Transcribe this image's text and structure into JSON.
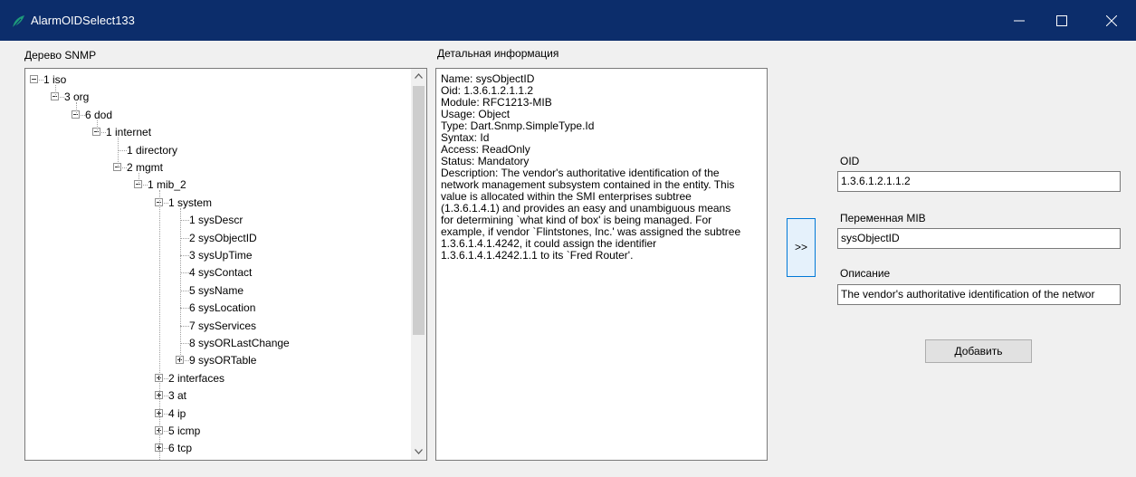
{
  "window": {
    "title": "AlarmOIDSelect133",
    "controls": {
      "minimize": "minimize-icon",
      "maximize": "maximize-icon",
      "close": "close-icon"
    },
    "title_bar_color": "#0c2d6b"
  },
  "tree_panel": {
    "label": "Дерево SNMP",
    "nodes": [
      {
        "label": "1 iso",
        "expanded": true
      },
      {
        "label": "3 org",
        "expanded": true
      },
      {
        "label": "6 dod",
        "expanded": true
      },
      {
        "label": "1 internet",
        "expanded": true
      },
      {
        "label": "1 directory"
      },
      {
        "label": "2 mgmt",
        "expanded": true
      },
      {
        "label": "1 mib_2",
        "expanded": true
      },
      {
        "label": "1 system",
        "expanded": true
      },
      {
        "label": "1 sysDescr"
      },
      {
        "label": "2 sysObjectID",
        "selected": true
      },
      {
        "label": "3 sysUpTime"
      },
      {
        "label": "4 sysContact"
      },
      {
        "label": "5 sysName"
      },
      {
        "label": "6 sysLocation"
      },
      {
        "label": "7 sysServices"
      },
      {
        "label": "8 sysORLastChange"
      },
      {
        "label": "9 sysORTable",
        "expanded": false
      },
      {
        "label": "2 interfaces",
        "expanded": false
      },
      {
        "label": "3 at",
        "expanded": false
      },
      {
        "label": "4 ip",
        "expanded": false
      },
      {
        "label": "5 icmp",
        "expanded": false
      },
      {
        "label": "6 tcp",
        "expanded": false
      }
    ]
  },
  "detail_panel": {
    "label": "Детальная информация",
    "lines": [
      "Name: sysObjectID",
      "Oid: 1.3.6.1.2.1.1.2",
      "Module: RFC1213-MIB",
      "Usage: Object",
      "Type: Dart.Snmp.SimpleType.Id",
      "Syntax: Id",
      "Access: ReadOnly",
      "Status: Mandatory",
      "Description: The vendor's authoritative identification of the",
      "network management subsystem contained in the entity. This",
      "value is allocated within the SMI enterprises subtree",
      "(1.3.6.1.4.1) and provides an easy and unambiguous means",
      "for determining `what kind of box' is being managed. For",
      "example, if vendor `Flintstones, Inc.' was assigned the subtree",
      "1.3.6.1.4.1.4242, it could assign the identifier",
      "1.3.6.1.4.1.4242.1.1 to its `Fred Router'."
    ]
  },
  "transfer_button": {
    "label": ">>"
  },
  "form": {
    "oid": {
      "label": "OID",
      "value": "1.3.6.1.2.1.1.2"
    },
    "mib_variable": {
      "label": "Переменная MIB",
      "value": "sysObjectID"
    },
    "description": {
      "label": "Описание",
      "value": "The vendor's authoritative identification of the networ"
    },
    "add_button": "Добавить"
  }
}
